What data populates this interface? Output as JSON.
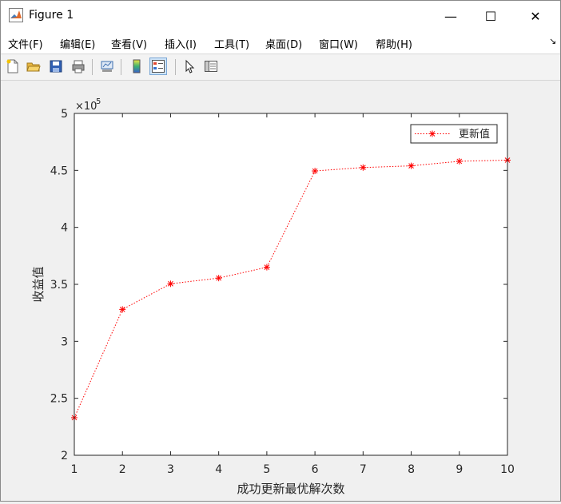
{
  "window": {
    "title": "Figure 1",
    "minimize_glyph": "—",
    "maximize_glyph": "☐",
    "close_glyph": "✕"
  },
  "menu": [
    {
      "label": "文件(F)"
    },
    {
      "label": "编辑(E)"
    },
    {
      "label": "查看(V)"
    },
    {
      "label": "插入(I)"
    },
    {
      "label": "工具(T)"
    },
    {
      "label": "桌面(D)"
    },
    {
      "label": "窗口(W)"
    },
    {
      "label": "帮助(H)"
    }
  ],
  "menu_overflow_glyph": "↘",
  "toolbar": {
    "icons": [
      "new-figure-icon",
      "open-file-icon",
      "save-icon",
      "print-icon",
      "link-plot-icon",
      "colorbar-icon",
      "legend-icon",
      "pointer-icon",
      "property-editor-icon"
    ],
    "active": "legend-icon"
  },
  "chart_data": {
    "type": "line",
    "title": "",
    "xlabel": "成功更新最优解次数",
    "ylabel": "收益值",
    "x": [
      1,
      2,
      3,
      4,
      5,
      6,
      7,
      8,
      9,
      10
    ],
    "series": [
      {
        "name": "更新值",
        "values": [
          233000,
          328000,
          350500,
          355500,
          365000,
          449500,
          452500,
          454000,
          458000,
          459000
        ],
        "color": "#ff0000",
        "marker": "*",
        "line_style": "dotted"
      }
    ],
    "xlim": [
      1,
      10
    ],
    "ylim": [
      200000,
      500000
    ],
    "xticks": [
      "1",
      "2",
      "3",
      "4",
      "5",
      "6",
      "7",
      "8",
      "9",
      "10"
    ],
    "yticks": [
      "2",
      "2.5",
      "3",
      "3.5",
      "4",
      "4.5",
      "5"
    ],
    "y_exponent_base": "×10",
    "y_exponent_power": "5",
    "grid": false,
    "legend_position": "top-right"
  }
}
